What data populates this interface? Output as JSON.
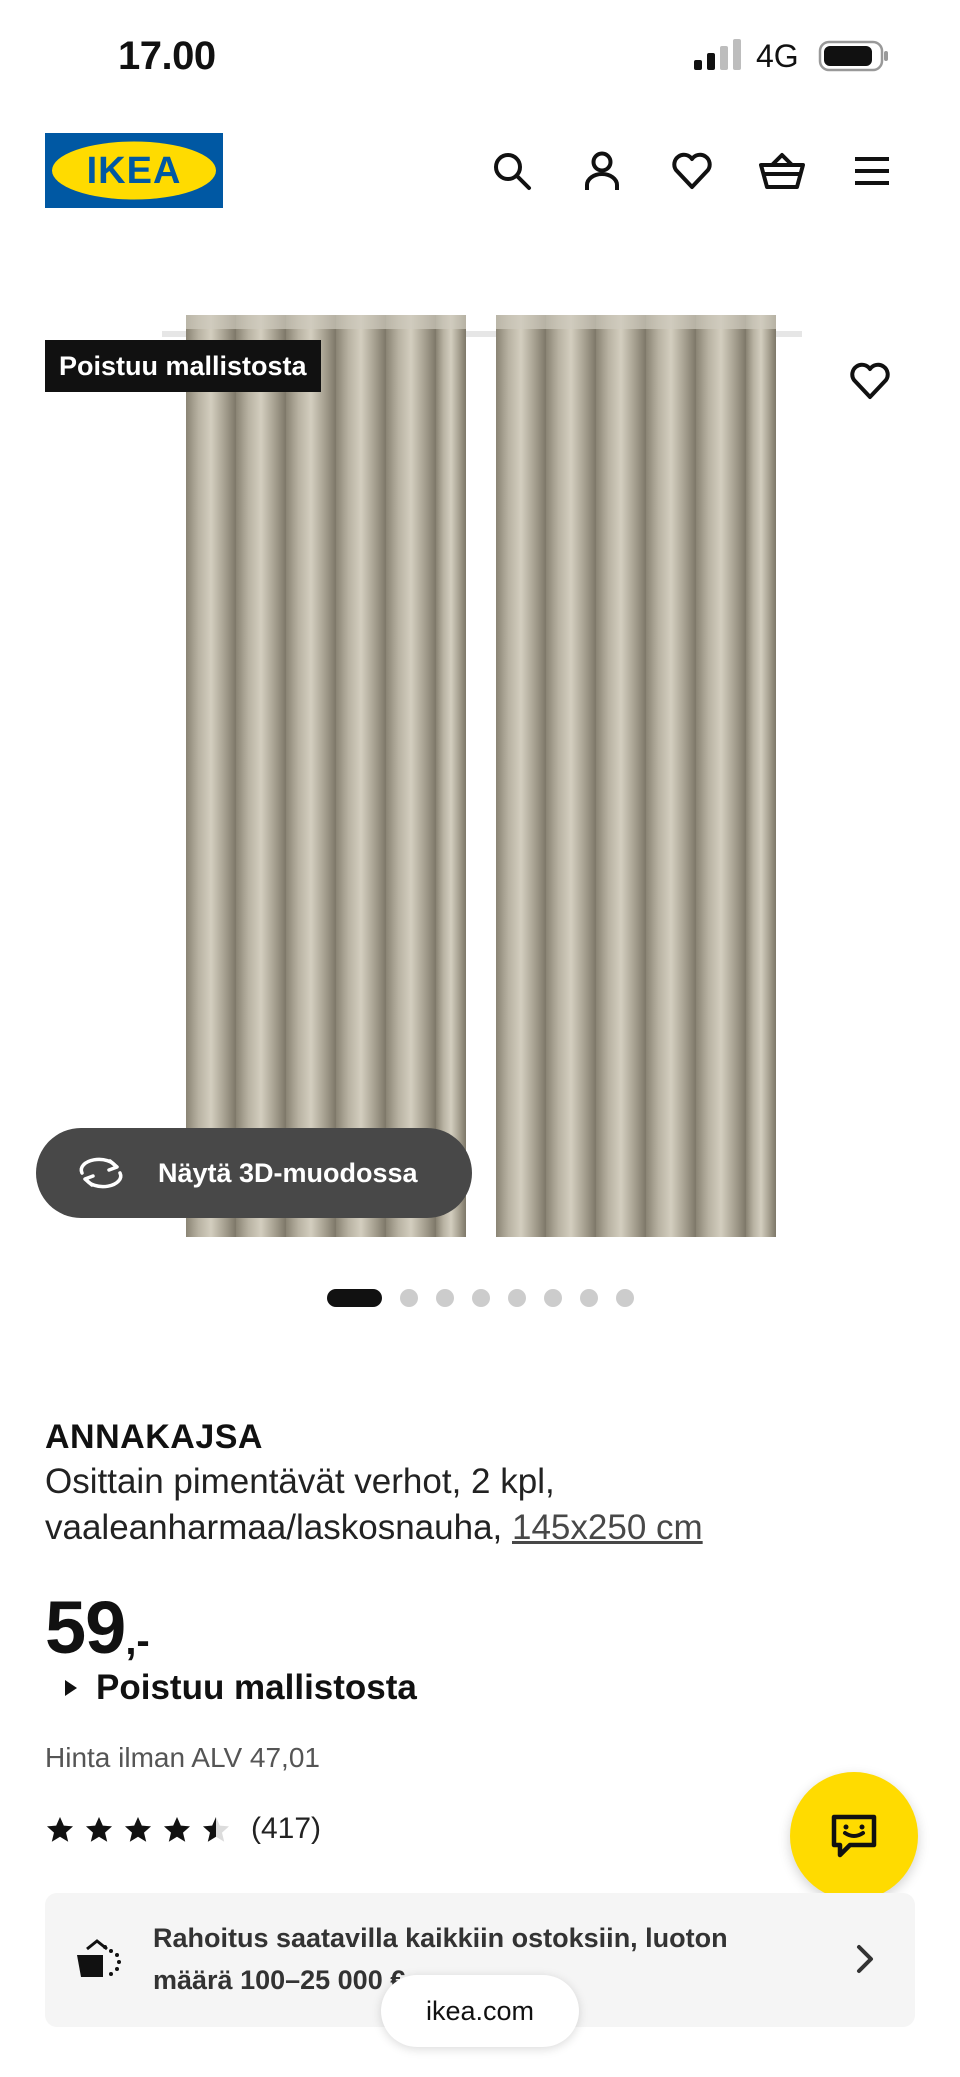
{
  "status_bar": {
    "time": "17.00",
    "network": "4G",
    "signal_icon": "cellular-signal-icon",
    "battery_icon": "battery-icon"
  },
  "header": {
    "logo_text": "IKEA",
    "logo_colors": {
      "blue": "#0058a3",
      "yellow": "#ffdb00"
    },
    "icons": [
      "search-icon",
      "account-icon",
      "heart-icon",
      "basket-icon",
      "menu-icon"
    ]
  },
  "product_image": {
    "badge": "Poistuu mallistosta",
    "view_3d_label": "Näytä 3D-muodossa",
    "carousel": {
      "count": 8,
      "active_index": 0
    }
  },
  "product": {
    "name": "ANNAKAJSA",
    "description": "Osittain pimentävät verhot, 2 kpl, vaaleanharmaa/laskosnauha,",
    "size": "145x250 cm",
    "price": "59",
    "price_suffix": ",-",
    "status": "Poistuu mallistosta",
    "price_ex_vat": "Hinta ilman ALV 47,01",
    "rating": 4.5,
    "rating_max": 5,
    "review_count": "(417)"
  },
  "financing": {
    "text": "Rahoitus saatavilla kaikkiin ostoksiin, luoton määrä 100–25 000 €",
    "icon": "financing-icon"
  },
  "chat": {
    "icon": "chat-icon",
    "color": "#ffdb00"
  },
  "browser": {
    "url": "ikea.com"
  }
}
